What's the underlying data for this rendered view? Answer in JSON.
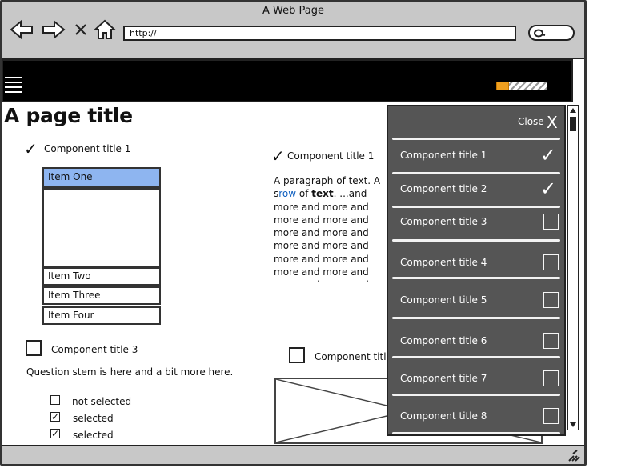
{
  "window": {
    "title": "A Web Page"
  },
  "address_bar": {
    "url": "http://"
  },
  "page": {
    "title": "A page title"
  },
  "header": {
    "progress": 0.25
  },
  "left": {
    "section1": {
      "title": "Component title 1",
      "checked": true
    },
    "list": {
      "selected": "Item One",
      "items": [
        "Item Two",
        "Item Three",
        "Item Four"
      ]
    },
    "section3": {
      "title": "Component title 3",
      "checked": false
    },
    "question": "Question stem is here and a bit more here.",
    "options": [
      {
        "label": "not selected",
        "checked": false
      },
      {
        "label": "selected",
        "checked": true
      },
      {
        "label": "selected",
        "checked": true
      }
    ]
  },
  "center": {
    "section1": {
      "title": "Component title 1",
      "checked": true
    },
    "para": {
      "lead": "A paragraph of text.  A s",
      "link": "row",
      "mid": " of ",
      "bold": "text",
      "rest": ". ...and more and more and more and more and more and more and more and more and more and more and more and more and more and more and more and more and more and more and more and more and more and more and more and more and more and more and more and more and more and more and more and more and more and more and more and more and more and more and more"
    },
    "section_bottom": {
      "title": "Component title",
      "checked": false
    }
  },
  "overlay": {
    "close_label": "Close",
    "close_glyph": "X",
    "items": [
      {
        "label": "Component title 1",
        "checked": true
      },
      {
        "label": "Component title 2",
        "checked": true
      },
      {
        "label": "Component title 3",
        "checked": false
      },
      {
        "label": "Component title 4",
        "checked": false
      },
      {
        "label": "Component title 5",
        "checked": false
      },
      {
        "label": "Component title 6",
        "checked": false
      },
      {
        "label": "Component title 7",
        "checked": false
      },
      {
        "label": "Component title 8",
        "checked": false
      }
    ]
  },
  "icons": {
    "check": "✓",
    "back": "back-arrow-icon",
    "forward": "forward-arrow-icon",
    "stop": "x-icon",
    "home": "home-icon",
    "search": "search-icon",
    "menu": "hamburger-icon",
    "resize": "resize-grip-icon"
  },
  "colors": {
    "selected_item": "#8eb5f0",
    "overlay_bg": "#555555",
    "header_bg": "#000000",
    "link": "#1060c0",
    "progress": "#f0a020"
  }
}
